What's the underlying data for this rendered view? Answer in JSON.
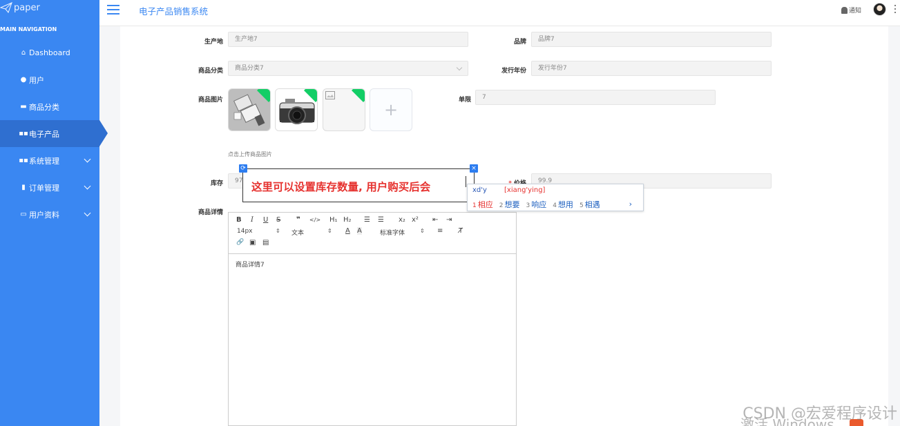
{
  "sidebar": {
    "brand": "paper",
    "nav_title": "MAIN NAVIGATION",
    "items": [
      {
        "label": "Dashboard",
        "icon": "home-icon"
      },
      {
        "label": "用户",
        "icon": "user-icon"
      },
      {
        "label": "商品分类",
        "icon": "folder-icon"
      },
      {
        "label": "电子产品",
        "icon": "grid-icon"
      },
      {
        "label": "系统管理",
        "icon": "grid-icon"
      },
      {
        "label": "订单管理",
        "icon": "clipboard-icon"
      },
      {
        "label": "用户资料",
        "icon": "card-icon"
      }
    ],
    "active_color": "#2f6fd0",
    "color": "#3a87f2"
  },
  "header": {
    "title": "电子产品销售系统",
    "notice": "通知"
  },
  "form": {
    "origin_label": "生产地",
    "origin_value": "生产地7",
    "brand_label": "品牌",
    "brand_value": "品牌7",
    "category_label": "商品分类",
    "category_value": "商品分类7",
    "year_label": "发行年份",
    "year_value": "发行年份7",
    "image_label": "商品图片",
    "limit_label": "单限",
    "limit_value": "7",
    "upload_hint": "点击上传商品图片",
    "stock_label": "库存",
    "stock_value": "97",
    "price_label": "价格",
    "price_required": "*",
    "price_value": "99.9",
    "detail_label": "商品详情"
  },
  "annotation": {
    "text": "这里可以设置库存数量, 用户购买后会"
  },
  "ime": {
    "input": "xd'y",
    "pinyin": "[xiang'ying]",
    "candidates": [
      {
        "n": "1",
        "text": "相应"
      },
      {
        "n": "2",
        "text": "想要"
      },
      {
        "n": "3",
        "text": "响应"
      },
      {
        "n": "4",
        "text": "想用"
      },
      {
        "n": "5",
        "text": "相遇"
      }
    ],
    "next": "›"
  },
  "editor": {
    "font_size": "14px",
    "paragraph": "文本",
    "font_family": "标准字体",
    "content": "商品详情7",
    "buttons": {
      "bold": "B",
      "italic": "I",
      "underline": "U",
      "strike": "S",
      "quote": "❞",
      "code": "</>",
      "h1": "H₁",
      "h2": "H₂",
      "ol": "☰",
      "ul": "☰",
      "sub": "x₂",
      "sup": "x²",
      "outdent": "⇤",
      "indent": "⇥",
      "color": "A",
      "bg": "A",
      "align": "≡",
      "clean": "T̸",
      "link": "🔗",
      "image": "▣",
      "video": "▤"
    }
  },
  "watermark": {
    "csdn": "CSDN @宏爱程序设计",
    "windows": "激活 Windows"
  }
}
